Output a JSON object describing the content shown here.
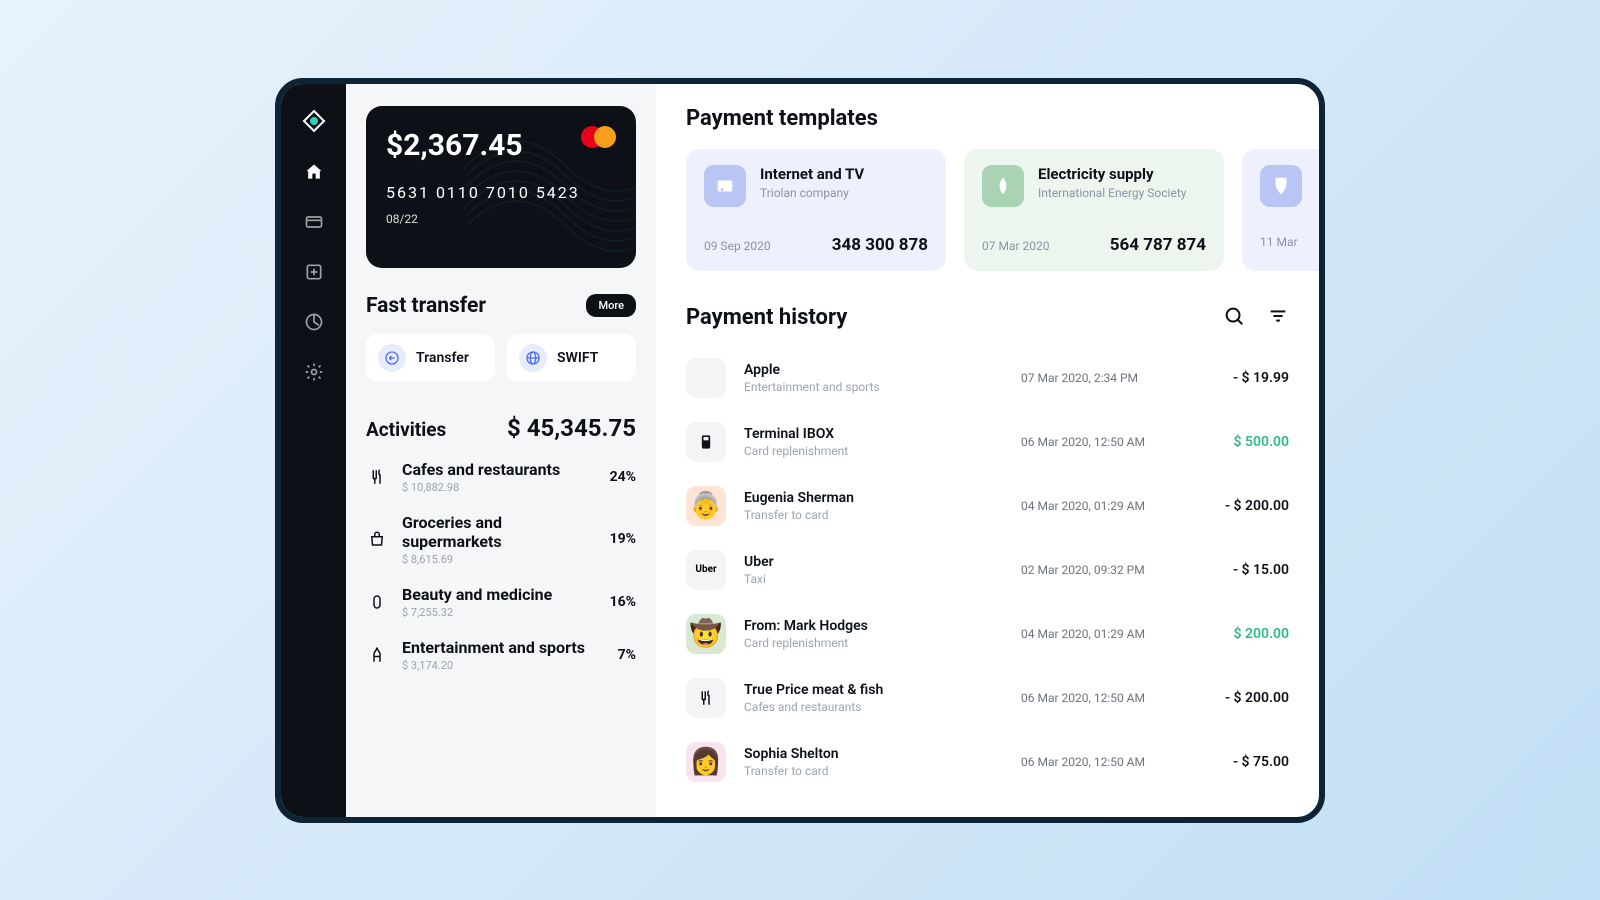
{
  "card": {
    "balance": "$2,367.45",
    "number": "5631  0110  7010  5423",
    "exp": "08/22"
  },
  "fast_transfer": {
    "title": "Fast transfer",
    "more": "More",
    "transfer": "Transfer",
    "swift": "SWIFT"
  },
  "activities": {
    "title": "Activities",
    "total": "$ 45,345.75",
    "items": [
      {
        "name": "Cafes and restaurants",
        "amount": "$ 10,882.98",
        "pct": "24%"
      },
      {
        "name": "Groceries and supermarkets",
        "amount": "$ 8,615.69",
        "pct": "19%"
      },
      {
        "name": "Beauty and medicine",
        "amount": "$ 7,255.32",
        "pct": "16%"
      },
      {
        "name": "Entertainment and sports",
        "amount": "$ 3,174.20",
        "pct": "7%"
      }
    ]
  },
  "templates": {
    "title": "Payment templates",
    "items": [
      {
        "name": "Internet and TV",
        "sub": "Triolan company",
        "date": "09 Sep 2020",
        "num": "348 300 878"
      },
      {
        "name": "Electricity supply",
        "sub": "International Energy Society",
        "date": "07 Mar 2020",
        "num": "564 787 874"
      },
      {
        "name": "",
        "sub": "",
        "date": "11 Mar",
        "num": ""
      }
    ]
  },
  "history": {
    "title": "Payment history",
    "rows": [
      {
        "name": "Apple",
        "cat": "Entertainment and sports",
        "date": "07 Mar 2020, 2:34 PM",
        "amt": "- $ 19.99",
        "pos": false
      },
      {
        "name": "Terminal IBOX",
        "cat": "Card replenishment",
        "date": "06 Mar 2020, 12:50 AM",
        "amt": "$ 500.00",
        "pos": true
      },
      {
        "name": "Eugenia Sherman",
        "cat": "Transfer to card",
        "date": "04 Mar 2020, 01:29 AM",
        "amt": "- $ 200.00",
        "pos": false
      },
      {
        "name": "Uber",
        "cat": "Taxi",
        "date": "02 Mar 2020, 09:32 PM",
        "amt": "- $ 15.00",
        "pos": false
      },
      {
        "name": "From: Mark Hodges",
        "cat": "Card replenishment",
        "date": "04 Mar 2020, 01:29 AM",
        "amt": "$ 200.00",
        "pos": true
      },
      {
        "name": "True Price meat & fish",
        "cat": "Cafes and restaurants",
        "date": "06 Mar 2020, 12:50 AM",
        "amt": "- $ 200.00",
        "pos": false
      },
      {
        "name": "Sophia Shelton",
        "cat": "Transfer to card",
        "date": "06 Mar 2020, 12:50 AM",
        "amt": "- $ 75.00",
        "pos": false
      }
    ]
  }
}
